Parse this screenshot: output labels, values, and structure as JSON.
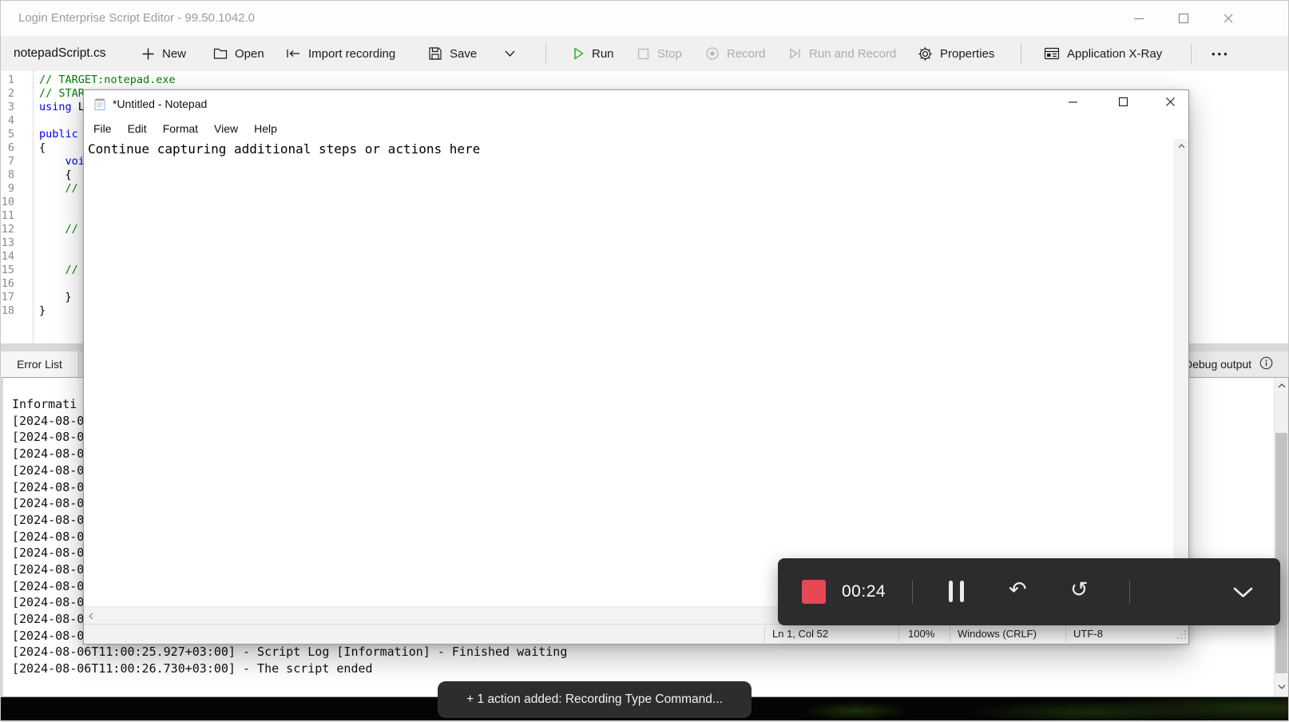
{
  "window": {
    "title": "Login Enterprise Script Editor - 99.50.1042.0"
  },
  "toolbar": {
    "file_tab": "notepadScript.cs",
    "new": "New",
    "open": "Open",
    "import": "Import recording",
    "save": "Save",
    "run": "Run",
    "stop": "Stop",
    "record": "Record",
    "run_and_record": "Run and Record",
    "properties": "Properties",
    "xray": "Application X-Ray",
    "more": "•••"
  },
  "editor": {
    "lines": [
      {
        "num": "1",
        "comment": "// TARGET:notepad.exe"
      },
      {
        "num": "2",
        "comment": "// STAR"
      },
      {
        "num": "3",
        "keyword": "using",
        "plain": " L"
      },
      {
        "num": "4"
      },
      {
        "num": "5",
        "keyword": "public"
      },
      {
        "num": "6",
        "plain": "{"
      },
      {
        "num": "7",
        "plain": "    ",
        "keyword": "voi"
      },
      {
        "num": "8",
        "plain": "    {"
      },
      {
        "num": "9",
        "comment": "    //"
      },
      {
        "num": "10"
      },
      {
        "num": "11"
      },
      {
        "num": "12",
        "comment": "    //"
      },
      {
        "num": "13"
      },
      {
        "num": "14"
      },
      {
        "num": "15",
        "comment": "    //"
      },
      {
        "num": "16"
      },
      {
        "num": "17",
        "plain": "    }"
      },
      {
        "num": "18",
        "plain": "}"
      }
    ]
  },
  "tabs": {
    "error_list": "Error List",
    "debug_output": "Debug output"
  },
  "log": {
    "lines": [
      "Informati",
      "[2024-08-0",
      "[2024-08-0",
      "[2024-08-0",
      "[2024-08-0",
      "[2024-08-0",
      "[2024-08-0",
      "[2024-08-0",
      "[2024-08-0",
      "[2024-08-0",
      "[2024-08-0",
      "[2024-08-0",
      "[2024-08-0",
      "[2024-08-0",
      "[2024-08-0",
      "[2024-08-06T11:00:25.927+03:00] - Script Log [Information] - Finished waiting",
      "[2024-08-06T11:00:26.730+03:00] - The script ended"
    ]
  },
  "notepad": {
    "title": "*Untitled - Notepad",
    "menu": [
      "File",
      "Edit",
      "Format",
      "View",
      "Help"
    ],
    "content": "Continue capturing additional steps or actions here",
    "status": {
      "cursor": "Ln 1, Col 52",
      "zoom": "100%",
      "line_ending": "Windows (CRLF)",
      "encoding": "UTF-8"
    }
  },
  "recorder": {
    "time": "00:24"
  },
  "toast": {
    "message": "+ 1 action added: Recording Type Command..."
  },
  "icons": {
    "undo": "↶",
    "reset": "↺",
    "more": "•••",
    "pause": "two-vertical-bars",
    "record_stop": "red-square",
    "chevron_down": "v-chevron",
    "info": "circled-i"
  },
  "colors": {
    "accent_green": "#35b43a",
    "record_red": "#e74856",
    "dark_overlay": "#2c2c2e",
    "comment_green": "#008000",
    "keyword_blue": "#0000f0",
    "title_gray": "#9c9c9c"
  }
}
